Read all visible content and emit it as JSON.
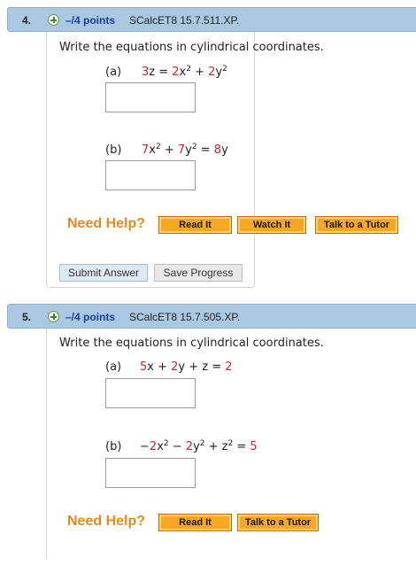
{
  "questions": [
    {
      "number": "4.",
      "points": "–/4 points",
      "id": "SCalcET8 15.7.511.XP.",
      "prompt": "Write the equations in cylindrical coordinates.",
      "parts": [
        {
          "label": "(a)",
          "segments": [
            [
              "r",
              "3"
            ],
            [
              "n",
              "z = "
            ],
            [
              "r",
              "2"
            ],
            [
              "n",
              "x"
            ],
            [
              "s",
              "2"
            ],
            [
              "n",
              " + "
            ],
            [
              "r",
              "2"
            ],
            [
              "n",
              "y"
            ],
            [
              "s",
              "2"
            ]
          ]
        },
        {
          "label": "(b)",
          "segments": [
            [
              "r",
              "7"
            ],
            [
              "n",
              "x"
            ],
            [
              "s",
              "2"
            ],
            [
              "n",
              " + "
            ],
            [
              "r",
              "7"
            ],
            [
              "n",
              "y"
            ],
            [
              "s",
              "2"
            ],
            [
              "n",
              " = "
            ],
            [
              "r",
              "8"
            ],
            [
              "n",
              "y"
            ]
          ]
        }
      ],
      "need_help": "Need Help?",
      "help_buttons": [
        "Read It",
        "Watch It",
        "Talk to a Tutor"
      ],
      "submit_label": "Submit Answer",
      "save_label": "Save Progress"
    },
    {
      "number": "5.",
      "points": "–/4 points",
      "id": "SCalcET8 15.7.505.XP.",
      "prompt": "Write the equations in cylindrical coordinates.",
      "parts": [
        {
          "label": "(a)",
          "segments": [
            [
              "r",
              "5"
            ],
            [
              "n",
              "x + "
            ],
            [
              "r",
              "2"
            ],
            [
              "n",
              "y + z = "
            ],
            [
              "r",
              "2"
            ]
          ]
        },
        {
          "label": "(b)",
          "segments": [
            [
              "n",
              "−"
            ],
            [
              "r",
              "2"
            ],
            [
              "n",
              "x"
            ],
            [
              "s",
              "2"
            ],
            [
              "n",
              " − "
            ],
            [
              "r",
              "2"
            ],
            [
              "n",
              "y"
            ],
            [
              "s",
              "2"
            ],
            [
              "n",
              " + z"
            ],
            [
              "s",
              "2"
            ],
            [
              "n",
              " = "
            ],
            [
              "r",
              "5"
            ]
          ]
        }
      ],
      "need_help": "Need Help?",
      "help_buttons": [
        "Read It",
        "Talk to a Tutor"
      ]
    }
  ],
  "colors": {
    "header_bg": "#abc8e2",
    "points_blue": "#1a3c9a",
    "need_help_orange": "#e8891c",
    "button_orange": "#f7a823",
    "coefficient_red": "#c62828"
  },
  "icons": {
    "expand": "plus-circle-icon"
  }
}
